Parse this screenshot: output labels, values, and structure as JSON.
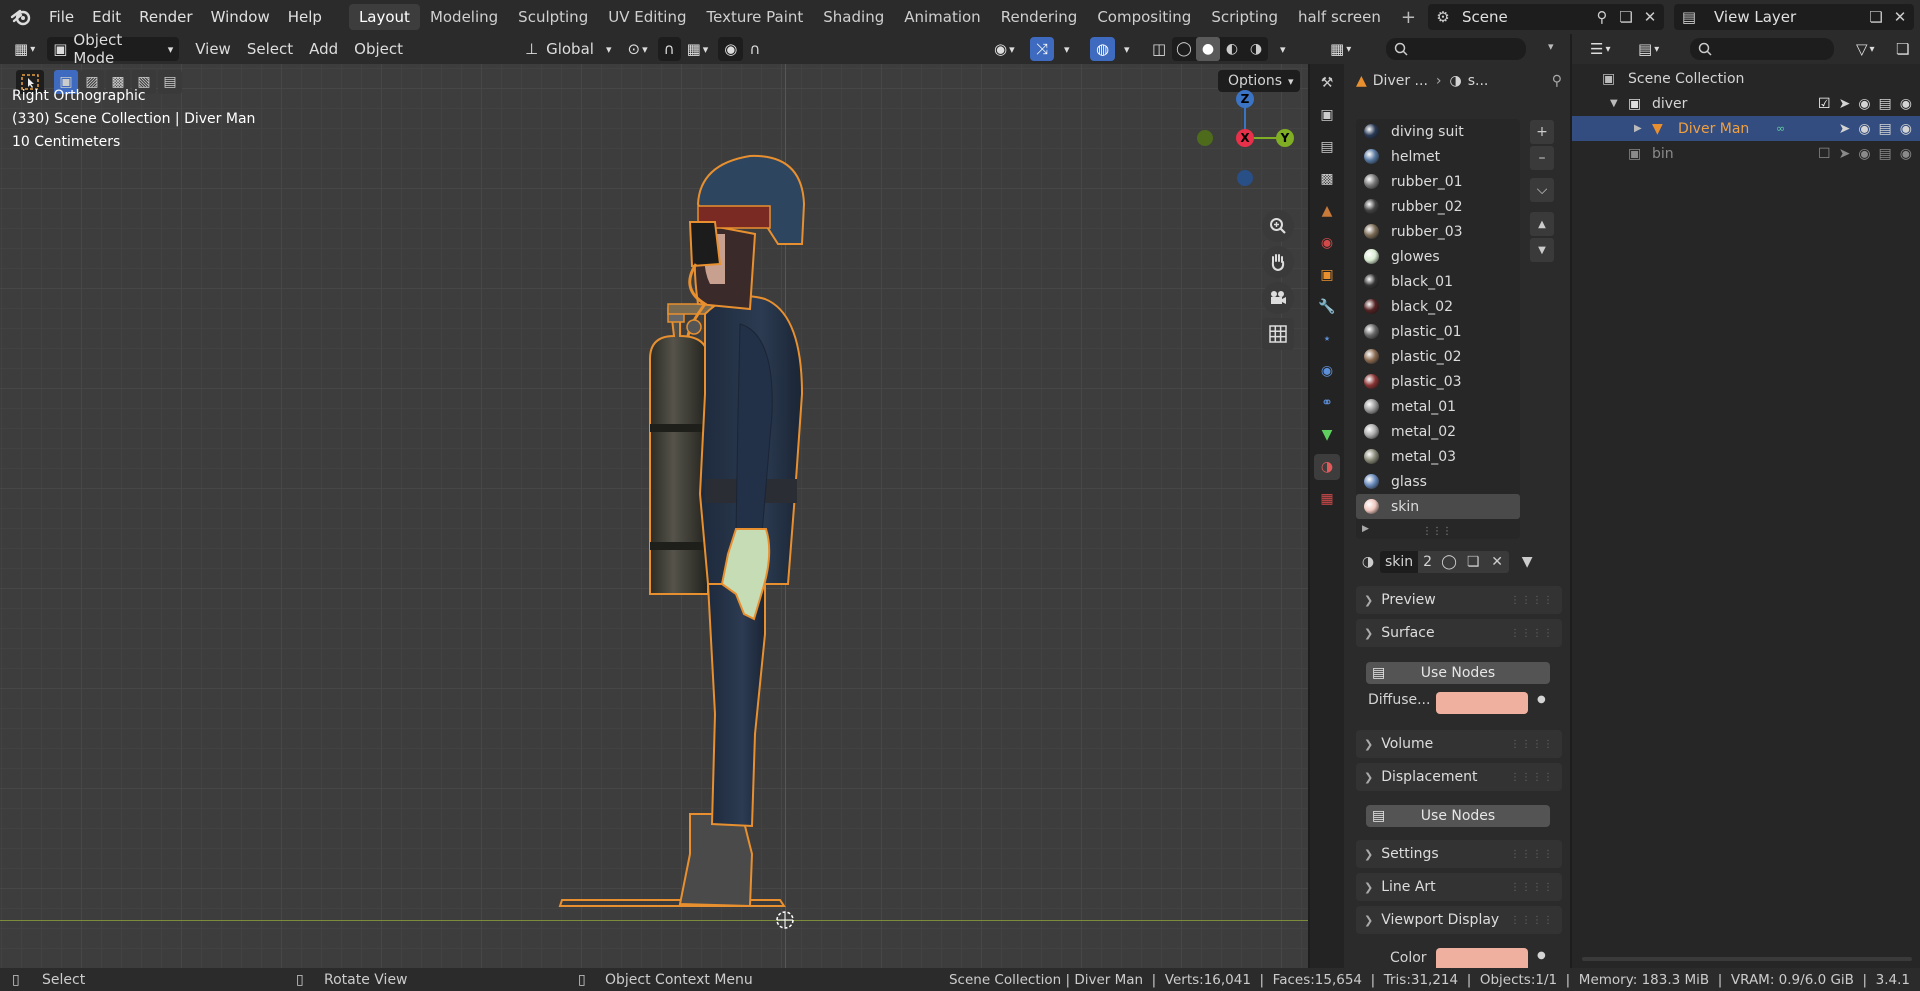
{
  "topbar": {
    "menus": [
      "File",
      "Edit",
      "Render",
      "Window",
      "Help"
    ],
    "workspace_tabs": [
      "Layout",
      "Modeling",
      "Sculpting",
      "UV Editing",
      "Texture Paint",
      "Shading",
      "Animation",
      "Rendering",
      "Compositing",
      "Scripting",
      "half screen"
    ],
    "active_tab": "Layout",
    "scene": "Scene",
    "view_layer": "View Layer"
  },
  "viewport_header": {
    "mode": "Object Mode",
    "menus": [
      "View",
      "Select",
      "Add",
      "Object"
    ],
    "orientation": "Global",
    "options_label": "Options"
  },
  "viewport": {
    "view_name": "Right Orthographic",
    "collection_info": "(330) Scene Collection | Diver Man",
    "scale_info": "10 Centimeters",
    "gizmo": {
      "z": "Z",
      "x": "X",
      "y": "Y"
    }
  },
  "properties": {
    "breadcrumb_object": "Diver ...",
    "breadcrumb_material": "s...",
    "materials": [
      {
        "name": "diving suit",
        "color": "#2a3a55"
      },
      {
        "name": "helmet",
        "color": "#5577a0"
      },
      {
        "name": "rubber_01",
        "color": "#777777"
      },
      {
        "name": "rubber_02",
        "color": "#444444"
      },
      {
        "name": "rubber_03",
        "color": "#7a6a55"
      },
      {
        "name": "glowes",
        "color": "#d8ead0"
      },
      {
        "name": "black_01",
        "color": "#333333"
      },
      {
        "name": "black_02",
        "color": "#552222"
      },
      {
        "name": "plastic_01",
        "color": "#666666"
      },
      {
        "name": "plastic_02",
        "color": "#8a6a50"
      },
      {
        "name": "plastic_03",
        "color": "#883333"
      },
      {
        "name": "metal_01",
        "color": "#999999"
      },
      {
        "name": "metal_02",
        "color": "#aaaaaa"
      },
      {
        "name": "metal_03",
        "color": "#888877"
      },
      {
        "name": "glass",
        "color": "#6688bb"
      },
      {
        "name": "skin",
        "color": "#f0c8c0"
      }
    ],
    "selected_material": "skin",
    "active_material_name": "skin",
    "user_count": "2",
    "panels": {
      "preview": "Preview",
      "surface": "Surface",
      "use_nodes": "Use Nodes",
      "diffuse_label": "Diffuse...",
      "diffuse_color": "#f0b0a0",
      "volume": "Volume",
      "displacement": "Displacement",
      "settings": "Settings",
      "line_art": "Line Art",
      "viewport_display": "Viewport Display",
      "color_label": "Color"
    }
  },
  "outliner": {
    "root": "Scene Collection",
    "items": [
      {
        "name": "diver",
        "type": "collection"
      },
      {
        "name": "Diver Man",
        "type": "object"
      },
      {
        "name": "bin",
        "type": "collection"
      }
    ]
  },
  "statusbar": {
    "select": "Select",
    "rotate_view": "Rotate View",
    "context_menu": "Object Context Menu",
    "stats": "Scene Collection | Diver Man  |  Verts:16,041  |  Faces:15,654  |  Tris:31,214  |  Objects:1/1  |  Memory: 183.3 MiB  |  VRAM: 0.9/6.0 GiB  |  3.4.1"
  }
}
